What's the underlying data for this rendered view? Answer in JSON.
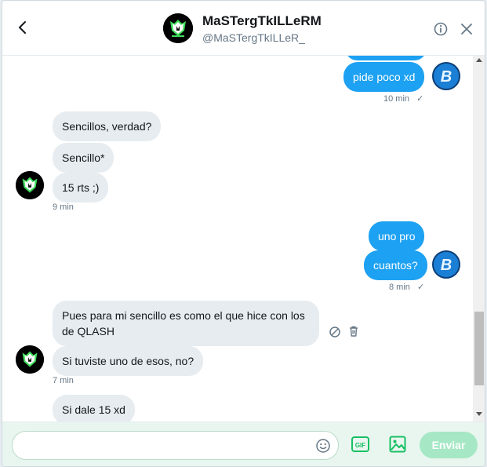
{
  "header": {
    "name": "MaSTergTkILLeRM",
    "handle": "@MaSTergTkILLeR_"
  },
  "messages": {
    "m0_partial": "",
    "m1": "pide poco xd",
    "m1_time": "10 min",
    "m2": "Sencillos, verdad?",
    "m3": "Sencillo*",
    "m4": "15 rts ;)",
    "m4_time": "9 min",
    "m5": "uno pro",
    "m6": "cuantos?",
    "m6_time": "8 min",
    "m7_line1": "Pues para mi sencillo es como el que hice con los",
    "m7_line2": "de QLASH",
    "m8": "Si tuviste uno de esos, no?",
    "m8_time": "7 min",
    "m9": "Si dale 15 xd",
    "read_check": "✓"
  },
  "composer": {
    "input_value": "",
    "send_label": "Enviar",
    "gif_label": "GIF"
  },
  "colors": {
    "accent": "#1da1f2",
    "incoming_bubble": "#e6ecf0",
    "send_disabled": "#a6e8c5"
  },
  "icons": {
    "back": "chevron-left-icon",
    "info": "info-icon",
    "close": "close-icon",
    "emoji": "emoji-icon",
    "gif": "gif-icon",
    "image": "image-icon",
    "block": "block-icon",
    "trash": "trash-icon"
  }
}
